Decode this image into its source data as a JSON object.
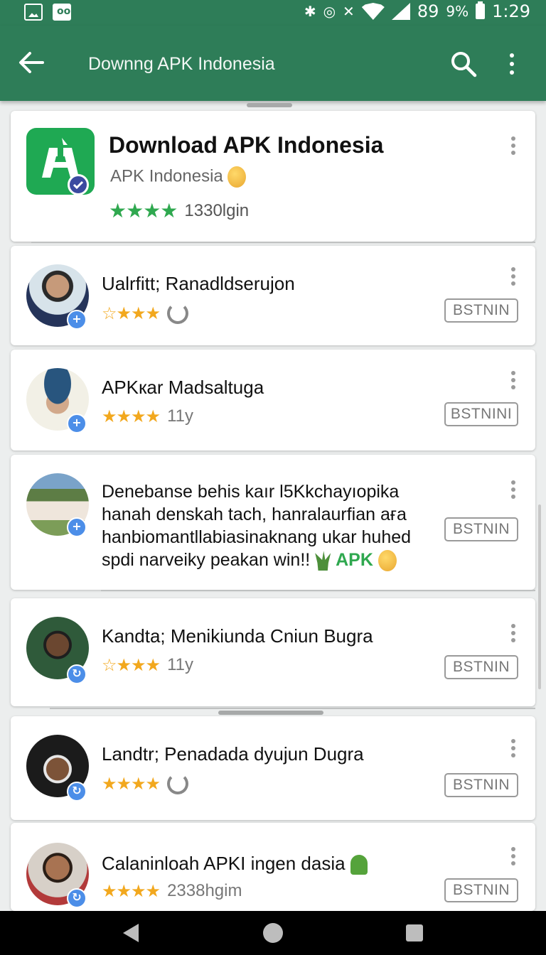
{
  "status_bar": {
    "network": "89",
    "battery": "9%",
    "time": "1:29"
  },
  "app_bar": {
    "title": "Downng APK Indonesia"
  },
  "app": {
    "name": "Download APK Indonesia",
    "developer": "APK Indonesia",
    "stars": "★★★★",
    "rating_count": "1330lgin",
    "color": "#1fa953"
  },
  "reviews": [
    {
      "name": "Ualrfitt; Ranadldserujon",
      "stars_outline": "☆",
      "stars": "★★★",
      "age": "",
      "button": "BSTNIN"
    },
    {
      "name": "APKкar Madsaltuga",
      "stars_outline": "",
      "stars": "★★★★",
      "age": "11y",
      "button": "BSTNINI"
    },
    {
      "text_lines": [
        "Denebanse behis kaır l5Kkchayıopika",
        "hanah denskah tach, hanralaurfiаn аға",
        "hanbiomantllabiasinaknang ukar huhed",
        "spdi narveiky peakan win!!"
      ],
      "apk_tag": "APK",
      "button": "BSTNIN"
    },
    {
      "name": "Kandta; Menikiunda Cniun Bugra",
      "stars_outline": "☆",
      "stars": "★★★",
      "age": "11y",
      "button": "BSTNIN"
    },
    {
      "name": "Landtr; Penadada dyujun Dugra",
      "stars_outline": "",
      "stars": "★★★★",
      "age": "",
      "button": "BSTNIN"
    },
    {
      "name": "Calaninloah APKI ingen dasia",
      "stars_outline": "",
      "stars": "★★★★",
      "age": "2338hgim",
      "button": "BSTNIN"
    }
  ],
  "colors": {
    "primary": "#2e7d58",
    "star_gold": "#f2a81e",
    "star_green": "#2fa84f"
  }
}
